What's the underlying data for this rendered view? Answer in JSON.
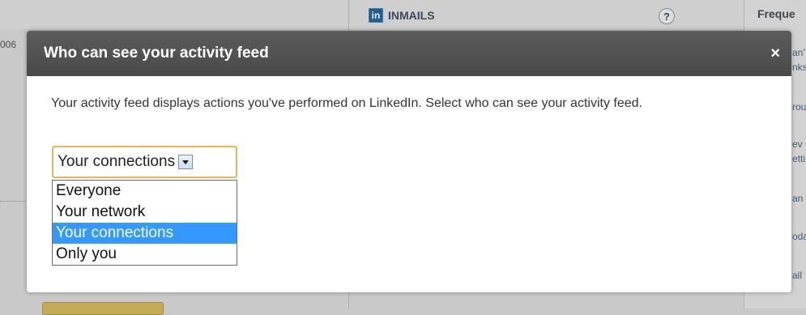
{
  "background": {
    "left_number": "006",
    "inmails_label": "INMAILS",
    "linkedin_logo_text": "in",
    "help_label": "?",
    "frequent_label": "Freque",
    "side_fragments": [
      "an'",
      "nks",
      "rou",
      "ev",
      "etti",
      "an",
      "oda",
      "all"
    ]
  },
  "modal": {
    "title": "Who can see your activity feed",
    "close_label": "×",
    "description": "Your activity feed displays actions you've performed on LinkedIn. Select who can see your activity feed.",
    "select": {
      "value": "Your connections",
      "options": [
        "Everyone",
        "Your network",
        "Your connections",
        "Only you"
      ],
      "selected_index": 2
    }
  },
  "colors": {
    "header_bg": "#4f4f4f",
    "select_focus_border": "#e0b75a",
    "option_highlight": "#3399ff"
  }
}
